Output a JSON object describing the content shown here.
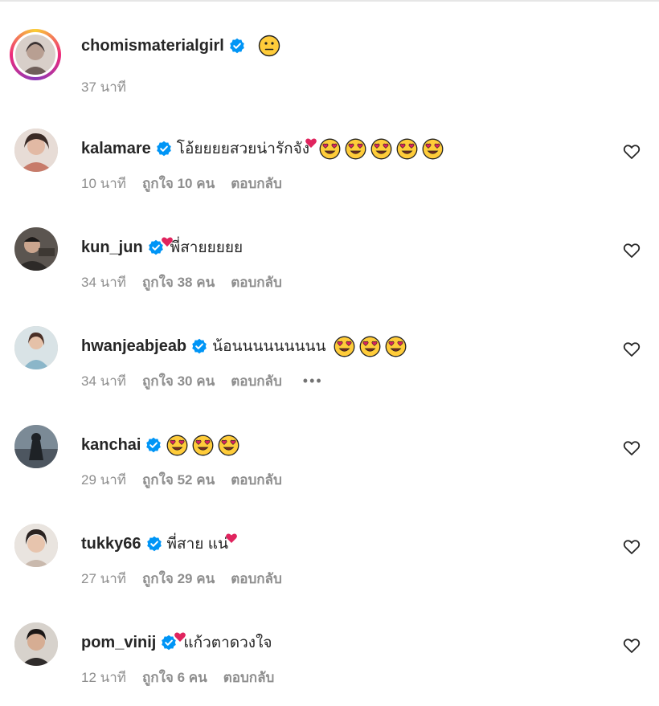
{
  "post_author": {
    "username": "chomismaterialgirl",
    "emoji": "neutral-face",
    "time": "37 นาที"
  },
  "comments": [
    {
      "username": "kalamare",
      "text": "โอ้ยยยยสวยน่ารักจัง",
      "heart_icon": true,
      "emoji_count": 5,
      "time": "10 นาที",
      "likes": "ถูกใจ 10 คน",
      "reply": "ตอบกลับ"
    },
    {
      "username": "kun_jun",
      "text": "พี่สายยยยย",
      "heart_icon": true,
      "emoji_count": 0,
      "time": "34 นาที",
      "likes": "ถูกใจ 38 คน",
      "reply": "ตอบกลับ"
    },
    {
      "username": "hwanjeabjeab",
      "text": "น้อนนนนนนนนน",
      "heart_icon": false,
      "emoji_count": 3,
      "time": "34 นาที",
      "likes": "ถูกใจ 30 คน",
      "reply": "ตอบกลับ",
      "more": "•••"
    },
    {
      "username": "kanchai",
      "text": "",
      "heart_icon": false,
      "emoji_count": 3,
      "time": "29 นาที",
      "likes": "ถูกใจ 52 คน",
      "reply": "ตอบกลับ"
    },
    {
      "username": "tukky66",
      "text": "พี่สาย แน่",
      "heart_icon": true,
      "emoji_count": 0,
      "time": "27 นาที",
      "likes": "ถูกใจ 29 คน",
      "reply": "ตอบกลับ"
    },
    {
      "username": "pom_vinij",
      "text": "แก้วตาดวงใจ",
      "heart_icon": true,
      "emoji_count": 0,
      "time": "12 นาที",
      "likes": "ถูกใจ 6 คน",
      "reply": "ตอบกลับ"
    }
  ],
  "icons": {
    "verified": "verified-badge-icon",
    "like": "heart-outline-icon",
    "emoji": "heart-eyes-emoji"
  },
  "colors": {
    "verified_blue": "#0095f6",
    "text_primary": "#262626",
    "text_secondary": "#8e8e8e",
    "heart_red": "#e0245e"
  }
}
